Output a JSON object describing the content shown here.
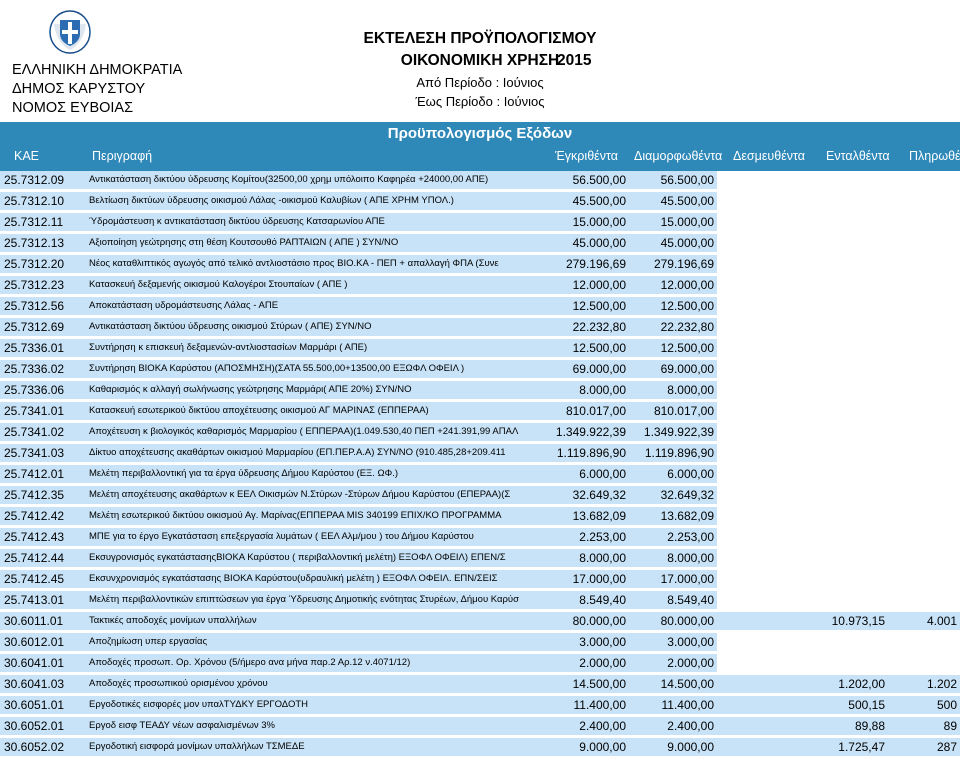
{
  "header": {
    "gov_line1": "ΕΛΛΗΝΙΚΗ ΔΗΜΟΚΡΑΤΙΑ",
    "gov_line2": "ΔΗΜΟΣ ΚΑΡΥΣΤΟΥ",
    "gov_line3": "ΝΟΜΟΣ ΕΥΒΟΙΑΣ",
    "title1": "ΕΚΤΕΛΕΣΗ ΠΡΟΫΠΟΛΟΓΙΣΜΟΥ",
    "title2": "ΟΙΚΟΝΟΜΙΚΗ ΧΡΗΣΗ",
    "year": "2015",
    "period_from": "Από Περίοδο :  Ιούνιος",
    "period_to": "Έως Περίοδο :  Ιούνιος"
  },
  "table": {
    "title": "Προϋπολογισμός Εξόδων",
    "columns": {
      "kae": "ΚΑΕ",
      "desc": "Περιγραφή",
      "approved": "Έγκριθέντα",
      "formed": "Διαμορφωθέντα",
      "committed": "Δεσμευθέντα",
      "ordered": "Ενταλθέντα",
      "paid": "Πληρωθέντα"
    },
    "rows": [
      {
        "kae": "25.7312.09",
        "desc": "Αντικατάσταση δικτύου ύδρευσης Κομίτου(32500,00 χρημ υπόλοιπο Καφηρέα +24000,00 ΑΠΕ)",
        "approved": "56.500,00",
        "formed": "56.500,00",
        "committed": "",
        "ordered": "",
        "paid": ""
      },
      {
        "kae": "25.7312.10",
        "desc": "Βελτίωση δικτύων ύδρευσης οικισμού Λάλας -οικισμού Καλυβίων ( ΑΠΕ ΧΡΗΜ ΥΠΟΛ.)",
        "approved": "45.500,00",
        "formed": "45.500,00",
        "committed": "",
        "ordered": "",
        "paid": ""
      },
      {
        "kae": "25.7312.11",
        "desc": "Ύδρομάστευση κ αντικατάσταση δικτύου ύδρευσης Κατσαρωνίου ΑΠΕ",
        "approved": "15.000,00",
        "formed": "15.000,00",
        "committed": "",
        "ordered": "",
        "paid": ""
      },
      {
        "kae": "25.7312.13",
        "desc": "Αξιοποίηση γεώτρησης  στη θέση  Κουτσουθό ΡΑΠΤΑΙΩΝ ( ΑΠΕ ) ΣΥΝ/ΝΟ",
        "approved": "45.000,00",
        "formed": "45.000,00",
        "committed": "",
        "ordered": "",
        "paid": ""
      },
      {
        "kae": "25.7312.20",
        "desc": "Νέος καταθλιπτικός αγωγός από τελικό αντλιοστάσιο προς ΒΙΟ.ΚΑ - ΠΕΠ + απαλλαγή ΦΠΑ (Συνε",
        "approved": "279.196,69",
        "formed": "279.196,69",
        "committed": "",
        "ordered": "",
        "paid": ""
      },
      {
        "kae": "25.7312.23",
        "desc": "Κατασκευή δεξαμενής οικισμού Καλογέροι Στουπαίων  ( ΑΠΕ )",
        "approved": "12.000,00",
        "formed": "12.000,00",
        "committed": "",
        "ordered": "",
        "paid": ""
      },
      {
        "kae": "25.7312.56",
        "desc": " Αποκατάσταση υδρομάστευσης  Λάλας - ΑΠΕ",
        "approved": "12.500,00",
        "formed": "12.500,00",
        "committed": "",
        "ordered": "",
        "paid": ""
      },
      {
        "kae": "25.7312.69",
        "desc": "Αντικατάσταση δικτύου ύδρευσης οικισμού Στύρων ( ΑΠΕ) ΣΥΝ/ΝΟ",
        "approved": "22.232,80",
        "formed": "22.232,80",
        "committed": "",
        "ordered": "",
        "paid": ""
      },
      {
        "kae": "25.7336.01",
        "desc": "Συντήρηση κ επισκευή δεξαμενών-αντλιοστασίων Μαρμάρι ( ΑΠΕ)",
        "approved": "12.500,00",
        "formed": "12.500,00",
        "committed": "",
        "ordered": "",
        "paid": ""
      },
      {
        "kae": "25.7336.02",
        "desc": "Συντήρηση ΒΙΟΚΑ Καρύστου (ΑΠΟΣΜΗΣΗ)(ΣΑΤΑ 55.500,00+13500,00 ΕΞΩΦΛ ΟΦΕΙΛ )",
        "approved": "69.000,00",
        "formed": "69.000,00",
        "committed": "",
        "ordered": "",
        "paid": ""
      },
      {
        "kae": "25.7336.06",
        "desc": "Καθαρισμός κ αλλαγή σωλήνωσης  γεώτρησης Μαρμάρι( ΑΠΕ 20%) ΣΥΝ/ΝΟ",
        "approved": "8.000,00",
        "formed": "8.000,00",
        "committed": "",
        "ordered": "",
        "paid": ""
      },
      {
        "kae": "25.7341.01",
        "desc": "Κατασκευή εσωτερικού δικτύου αποχέτευσης οικισμού ΑΓ ΜΑΡΙΝΑΣ (ΕΠΠΕΡΑΑ)",
        "approved": "810.017,00",
        "formed": "810.017,00",
        "committed": "",
        "ordered": "",
        "paid": ""
      },
      {
        "kae": "25.7341.02",
        "desc": "Αποχέτευση κ βιολογικός καθαρισμός Μαρμαρίου ( ΕΠΠΕΡΑΑ)(1.049.530,40 ΠΕΠ +241.391,99 ΑΠΑΛ",
        "approved": "1.349.922,39",
        "formed": "1.349.922,39",
        "committed": "",
        "ordered": "",
        "paid": ""
      },
      {
        "kae": "25.7341.03",
        "desc": "Δίκτυο αποχέτευσης ακαθάρτων οικισμού Μαρμαρίου (ΕΠ.ΠΕΡ.Α.Α) ΣΥΝ/ΝΟ (910.485,28+209.411",
        "approved": "1.119.896,90",
        "formed": "1.119.896,90",
        "committed": "",
        "ordered": "",
        "paid": ""
      },
      {
        "kae": "25.7412.01",
        "desc": "Μελέτη  περιβαλλοντική για τα έργα ύδρευσης  Δήμου Καρύστου (ΕΞ. ΩΦ.)",
        "approved": "6.000,00",
        "formed": "6.000,00",
        "committed": "",
        "ordered": "",
        "paid": ""
      },
      {
        "kae": "25.7412.35",
        "desc": "Μελέτη αποχέτευσης ακαθάρτων κ ΕΕΛ  Οικισμών Ν.Στύρων -Στύρων Δήμου Καρύστου (ΕΠΕΡΑΑ)(Σ",
        "approved": "32.649,32",
        "formed": "32.649,32",
        "committed": "",
        "ordered": "",
        "paid": ""
      },
      {
        "kae": "25.7412.42",
        "desc": "Μελέτη εσωτερικού δικτύου οικισμού Αγ. Μαρίνας(ΕΠΠΕΡΑΑ MIS 340199 ΕΠΙΧ/ΚΟ ΠΡΟΓΡΑΜΜΑ",
        "approved": "13.682,09",
        "formed": "13.682,09",
        "committed": "",
        "ordered": "",
        "paid": ""
      },
      {
        "kae": "25.7412.43",
        "desc": "ΜΠΕ για το έργο Εγκατάσταση επεξεργασία λυμάτων ( ΕΕΛ Αλμ/μου )  του Δήμου Καρύστου",
        "approved": "2.253,00",
        "formed": "2.253,00",
        "committed": "",
        "ordered": "",
        "paid": ""
      },
      {
        "kae": "25.7412.44",
        "desc": "Εκσυγρονισμός εγκατάστασηςΒΙΟΚΑ Καρύστου ( περιβαλλοντική μελέτη) ΕΞΟΦΛ ΟΦΕΙΛ) ΕΠΕΝ/Σ",
        "approved": "8.000,00",
        "formed": "8.000,00",
        "committed": "",
        "ordered": "",
        "paid": ""
      },
      {
        "kae": "25.7412.45",
        "desc": "Εκσυνχρονισμός εγκατάστασης ΒΙΟΚΑ Καρύστου(υδραυλική μελέτη ) ΕΞΟΦΛ ΟΦΕΙΛ. ΕΠΝ/ΣΕΙΣ",
        "approved": "17.000,00",
        "formed": "17.000,00",
        "committed": "",
        "ordered": "",
        "paid": ""
      },
      {
        "kae": "25.7413.01",
        "desc": "Μελέτη περιβαλλοντικών επιπτώσεων για έργα Ύδρευσης Δημοτικής ενότητας Στυρέων, Δήμου Καρύσ",
        "approved": "8.549,40",
        "formed": "8.549,40",
        "committed": "",
        "ordered": "",
        "paid": ""
      },
      {
        "kae": "30.6011.01",
        "desc": "Τακτικές  αποδοχές μονίμων υπαλλήλων",
        "approved": "80.000,00",
        "formed": "80.000,00",
        "committed": "",
        "ordered": "10.973,15",
        "paid": "4.001"
      },
      {
        "kae": "30.6012.01",
        "desc": "Αποζημίωση υπερ εργασίας",
        "approved": "3.000,00",
        "formed": "3.000,00",
        "committed": "",
        "ordered": "",
        "paid": ""
      },
      {
        "kae": "30.6041.01",
        "desc": "Αποδοχές προσωπ. Ορ. Χρόνου (5/ήμερο ανα μήνα παρ.2 Αρ.12 ν.4071/12)",
        "approved": "2.000,00",
        "formed": "2.000,00",
        "committed": "",
        "ordered": "",
        "paid": ""
      },
      {
        "kae": "30.6041.03",
        "desc": "Αποδοχές προσωπικού ορισμένου χρόνου",
        "approved": "14.500,00",
        "formed": "14.500,00",
        "committed": "",
        "ordered": "1.202,00",
        "paid": "1.202"
      },
      {
        "kae": "30.6051.01",
        "desc": "Εργοδοτικές εισφορές μον υπαλΤΥΔΚΥ ΕΡΓΟΔΟΤΗ",
        "approved": "11.400,00",
        "formed": "11.400,00",
        "committed": "",
        "ordered": "500,15",
        "paid": "500"
      },
      {
        "kae": "30.6052.01",
        "desc": "Εργοδ εισφ ΤΕΑΔΥ νέων ασφαλισμένων 3%",
        "approved": "2.400,00",
        "formed": "2.400,00",
        "committed": "",
        "ordered": "89,88",
        "paid": "89"
      },
      {
        "kae": "30.6052.02",
        "desc": "Εργοδοτική εισφορά μονίμων υπαλλήλων ΤΣΜΕΔΕ",
        "approved": "9.000,00",
        "formed": "9.000,00",
        "committed": "",
        "ordered": "1.725,47",
        "paid": "287"
      }
    ]
  },
  "colors": {
    "header_bar": "#2e88b8",
    "row_fill": "#c8e3f7"
  }
}
